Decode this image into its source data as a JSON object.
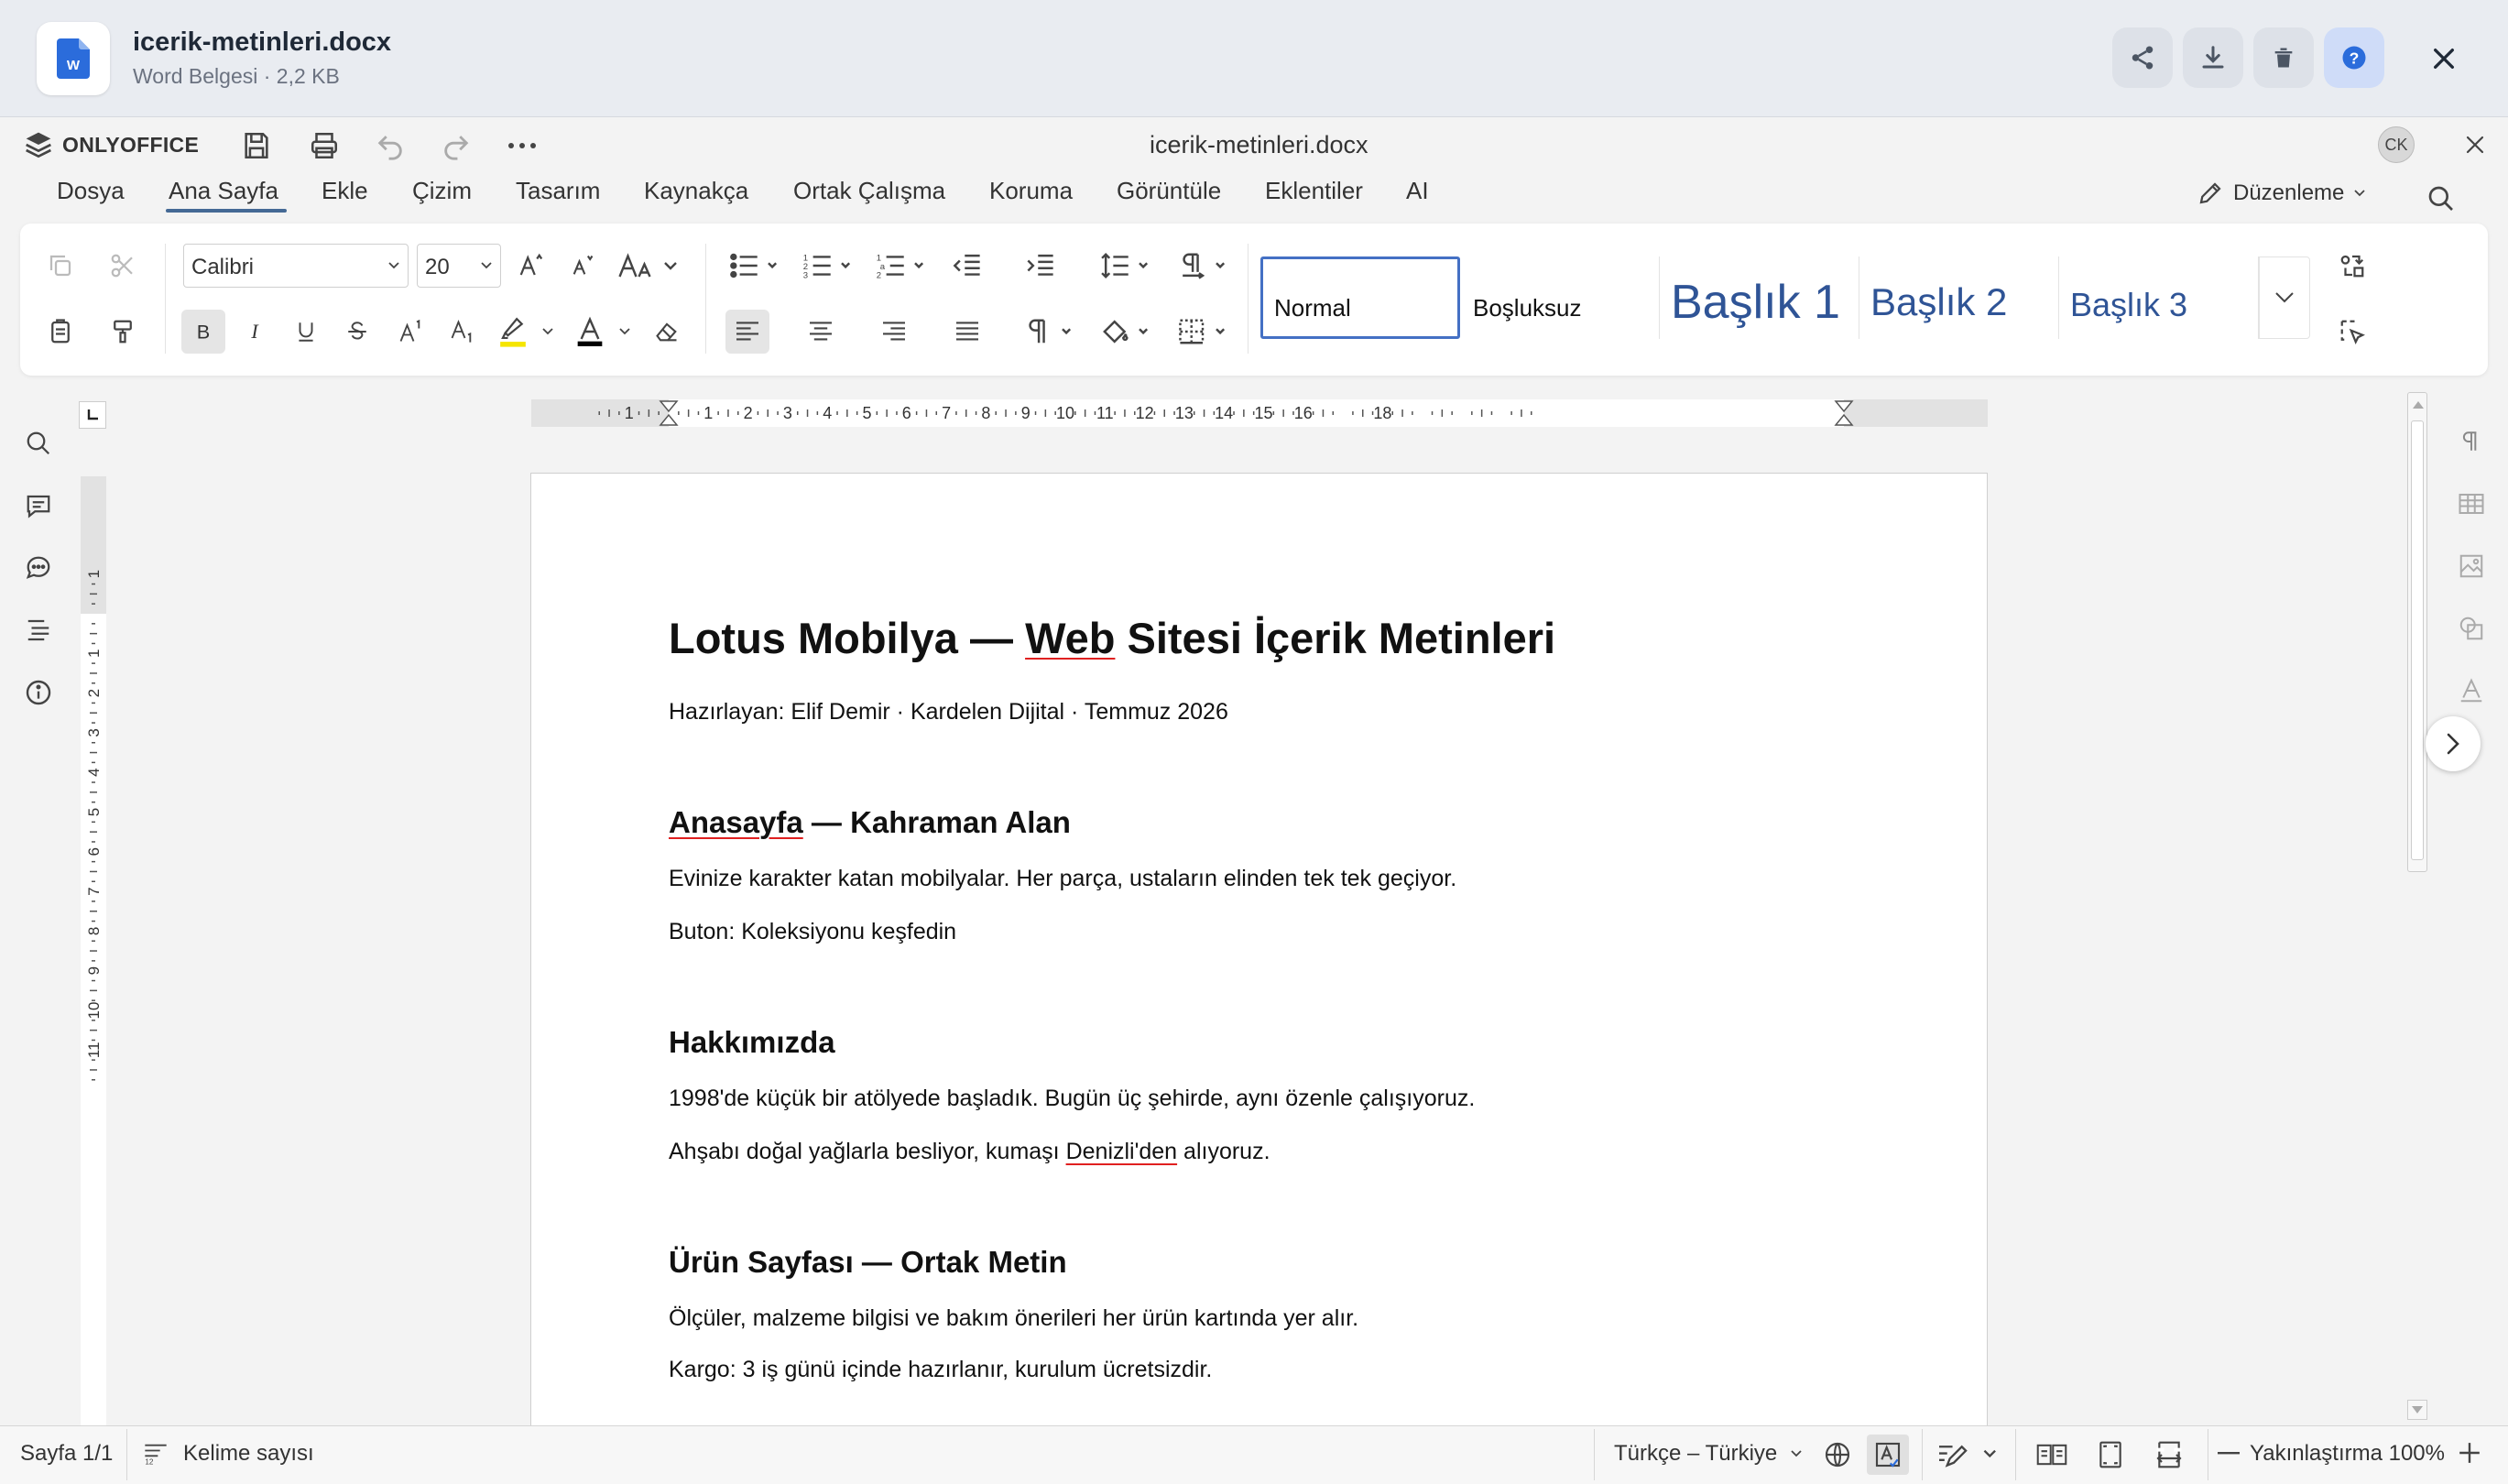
{
  "outer_bar": {
    "file_name": "icerik-metinleri.docx",
    "file_meta": "Word Belgesi · 2,2 KB",
    "actions": [
      "share-icon",
      "download-icon",
      "trash-icon",
      "help-icon",
      "close-icon"
    ]
  },
  "editor": {
    "logo": "ONLYOFFICE",
    "doc_title": "icerik-metinleri.docx",
    "avatar": "CK",
    "tabs": [
      "Dosya",
      "Ana Sayfa",
      "Ekle",
      "Çizim",
      "Tasarım",
      "Kaynakça",
      "Ortak Çalışma",
      "Koruma",
      "Görüntüle",
      "Eklentiler",
      "AI"
    ],
    "active_tab": "Ana Sayfa",
    "mode": "Düzenleme"
  },
  "toolbar": {
    "font_name": "Calibri",
    "font_size": "20",
    "styles": [
      "Normal",
      "Boşluksuz",
      "Başlık 1",
      "Başlık 2",
      "Başlık 3"
    ],
    "highlight_color": "#f5e500",
    "font_color": "#000000"
  },
  "ruler": {
    "h_labels": [
      "1",
      "1",
      "2",
      "3",
      "4",
      "5",
      "6",
      "7",
      "8",
      "9",
      "10",
      "11",
      "12",
      "13",
      "14",
      "15",
      "16",
      "18"
    ],
    "v_labels": [
      "1",
      "1",
      "2",
      "3",
      "4",
      "5",
      "6",
      "7",
      "8",
      "9",
      "10",
      "11"
    ]
  },
  "document": {
    "title_pre": "Lotus Mobilya — ",
    "title_err": "Web",
    "title_post": " Sitesi İçerik Metinleri",
    "byline": "Hazırlayan: Elif Demir · Kardelen Dijital · Temmuz 2026",
    "s1_heading_err": "Anasayfa",
    "s1_heading_post": " — Kahraman Alan",
    "s1_p1": "Evinize karakter katan mobilyalar. Her parça, ustaların elinden tek tek geçiyor.",
    "s1_p2": "Buton: Koleksiyonu keşfedin",
    "s2_heading": "Hakkımızda",
    "s2_p1": "1998'de küçük bir atölyede başladık. Bugün üç şehirde, aynı özenle çalışıyoruz.",
    "s2_p2_pre": "Ahşabı doğal yağlarla besliyor, kumaşı ",
    "s2_p2_err": "Denizli'den",
    "s2_p2_post": " alıyoruz.",
    "s3_heading": "Ürün Sayfası — Ortak Metin",
    "s3_p1": "Ölçüler, malzeme bilgisi ve bakım önerileri her ürün kartında yer alır.",
    "s3_p2": "Kargo: 3 iş günü içinde hazırlanır, kurulum ücretsizdir."
  },
  "status": {
    "page": "Sayfa 1/1",
    "word_count": "Kelime sayısı",
    "language": "Türkçe – Türkiye",
    "zoom": "Yakınlaştırma 100%"
  },
  "colors": {
    "accent": "#446995",
    "word_blue": "#2b6cdb",
    "spell_error": "#e02020"
  }
}
